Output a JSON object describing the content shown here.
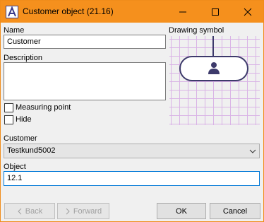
{
  "window": {
    "title": "Customer object (21.16)",
    "accent_color": "#f5901d",
    "app_icon": "app-logo-icon",
    "controls": [
      "minimize-icon",
      "maximize-icon",
      "close-icon"
    ]
  },
  "form": {
    "name_label": "Name",
    "name_value": "Customer",
    "description_label": "Description",
    "description_value": "",
    "measuring_point_label": "Measuring point",
    "measuring_point_checked": false,
    "hide_label": "Hide",
    "hide_checked": false,
    "customer_label": "Customer",
    "customer_value": "Testkund5002",
    "object_label": "Object",
    "object_value": "12.1"
  },
  "symbol": {
    "label": "Drawing symbol",
    "icon": "person-icon"
  },
  "buttons": {
    "back": "Back",
    "forward": "Forward",
    "ok": "OK",
    "cancel": "Cancel"
  }
}
